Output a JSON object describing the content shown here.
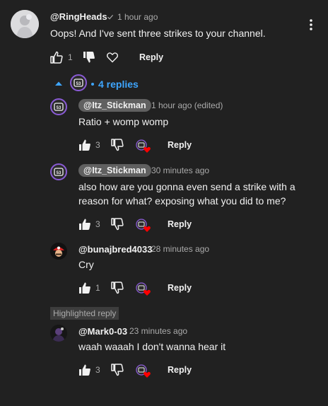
{
  "top_comment": {
    "author": "@RingHeads",
    "time": "1 hour ago",
    "text": "Oops! And I've sent three strikes to your channel.",
    "likes": "1",
    "reply_label": "Reply"
  },
  "replies_toggle": {
    "label": "4 replies"
  },
  "replies": [
    {
      "author": "@Itz_Stickman",
      "time": "1 hour ago (edited)",
      "text": "Ratio + womp womp",
      "likes": "3",
      "reply_label": "Reply"
    },
    {
      "author": "@Itz_Stickman",
      "time": "30 minutes ago",
      "text": "also how are you gonna even send a strike with a reason for what? exposing what you did to me?",
      "likes": "3",
      "reply_label": "Reply"
    },
    {
      "author": "@bunajbred4033",
      "time": "28 minutes ago",
      "text": "Cry",
      "likes": "1",
      "reply_label": "Reply"
    },
    {
      "author": "@Mark0-03",
      "time": "23 minutes ago",
      "text": "waah waaah I don't wanna hear it",
      "likes": "3",
      "reply_label": "Reply",
      "badge": "Highlighted reply"
    }
  ],
  "colors": {
    "background": "#212121",
    "link": "#3ea6ff",
    "muted": "#aaaaaa",
    "pill": "#606060",
    "heart": "#ff0000"
  }
}
